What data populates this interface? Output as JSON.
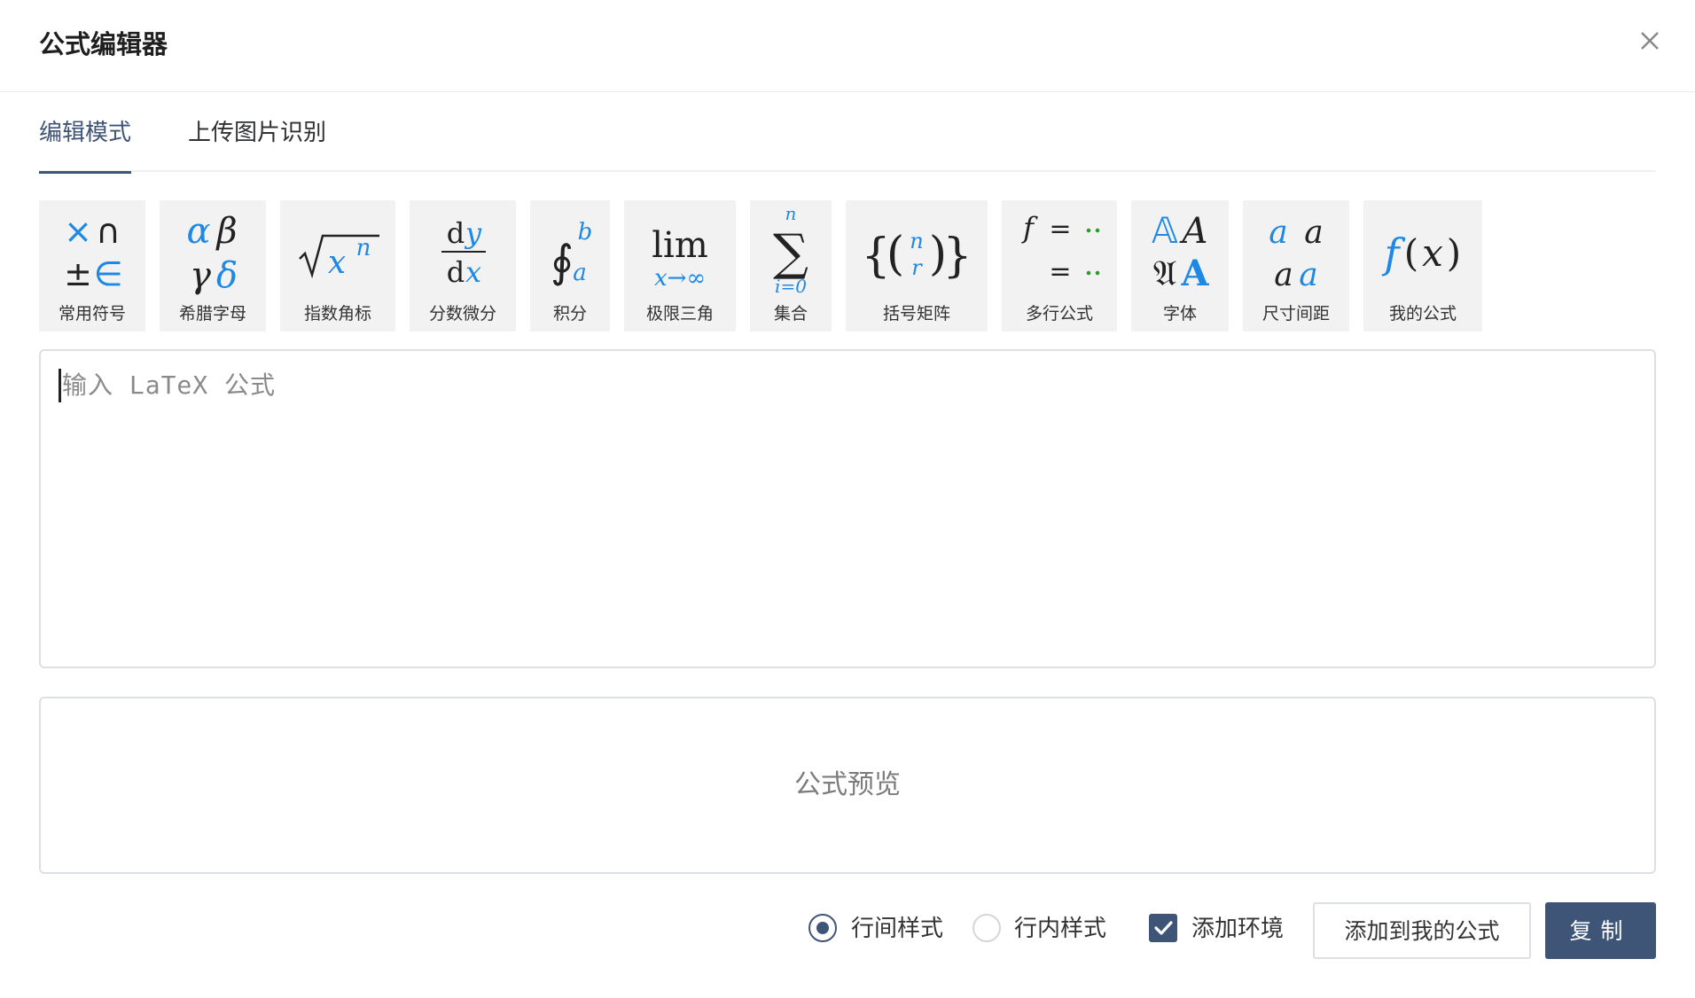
{
  "dialog": {
    "title": "公式编辑器",
    "close_icon": "close-icon"
  },
  "tabs": [
    {
      "label": "编辑模式",
      "active": true
    },
    {
      "label": "上传图片识别",
      "active": false
    }
  ],
  "toolbar": {
    "items": [
      {
        "label": "常用符号",
        "icon": "common-symbols-icon"
      },
      {
        "label": "希腊字母",
        "icon": "greek-letters-icon"
      },
      {
        "label": "指数角标",
        "icon": "exponent-subscript-icon"
      },
      {
        "label": "分数微分",
        "icon": "fraction-derivative-icon"
      },
      {
        "label": "积分",
        "icon": "integral-icon"
      },
      {
        "label": "极限三角",
        "icon": "limit-trig-icon"
      },
      {
        "label": "集合",
        "icon": "sum-set-icon"
      },
      {
        "label": "括号矩阵",
        "icon": "bracket-matrix-icon"
      },
      {
        "label": "多行公式",
        "icon": "multiline-formula-icon"
      },
      {
        "label": "字体",
        "icon": "font-icon"
      },
      {
        "label": "尺寸间距",
        "icon": "size-spacing-icon"
      },
      {
        "label": "我的公式",
        "icon": "my-formula-icon"
      }
    ],
    "glyphs": {
      "common": [
        "×",
        "∩",
        "±",
        "∈"
      ],
      "greek": [
        "α",
        "β",
        "γ",
        "δ"
      ],
      "sqrt_base": "x",
      "sqrt_exp": "n",
      "frac_top_d": "d",
      "frac_top_var": "y",
      "frac_bot_d": "d",
      "frac_bot_var": "x",
      "integral_upper": "b",
      "integral_lower": "a",
      "lim_word": "lim",
      "lim_sub": "x→∞",
      "sum_top": "n",
      "sum_bottom": "i=0",
      "binom_top": "n",
      "binom_bottom": "r",
      "multiline_f": "f",
      "font_a1": "𝔸",
      "font_a2": "A",
      "font_a3": "𝔄",
      "font_a4": "A",
      "size_a": "a",
      "myfx_f": "f",
      "myfx_x": "x"
    },
    "colors": {
      "accent_blue": "#1e88e5",
      "dots_green": "#2e9a2e"
    }
  },
  "editor": {
    "placeholder": "输入 LaTeX 公式"
  },
  "preview": {
    "placeholder": "公式预览"
  },
  "footer": {
    "display_style_label": "行间样式",
    "display_style_checked": true,
    "inline_style_label": "行内样式",
    "inline_style_checked": false,
    "add_env_label": "添加环境",
    "add_env_checked": true,
    "add_to_mine_label": "添加到我的公式",
    "copy_label": "复制"
  },
  "theme": {
    "primary": "#3f5578"
  }
}
